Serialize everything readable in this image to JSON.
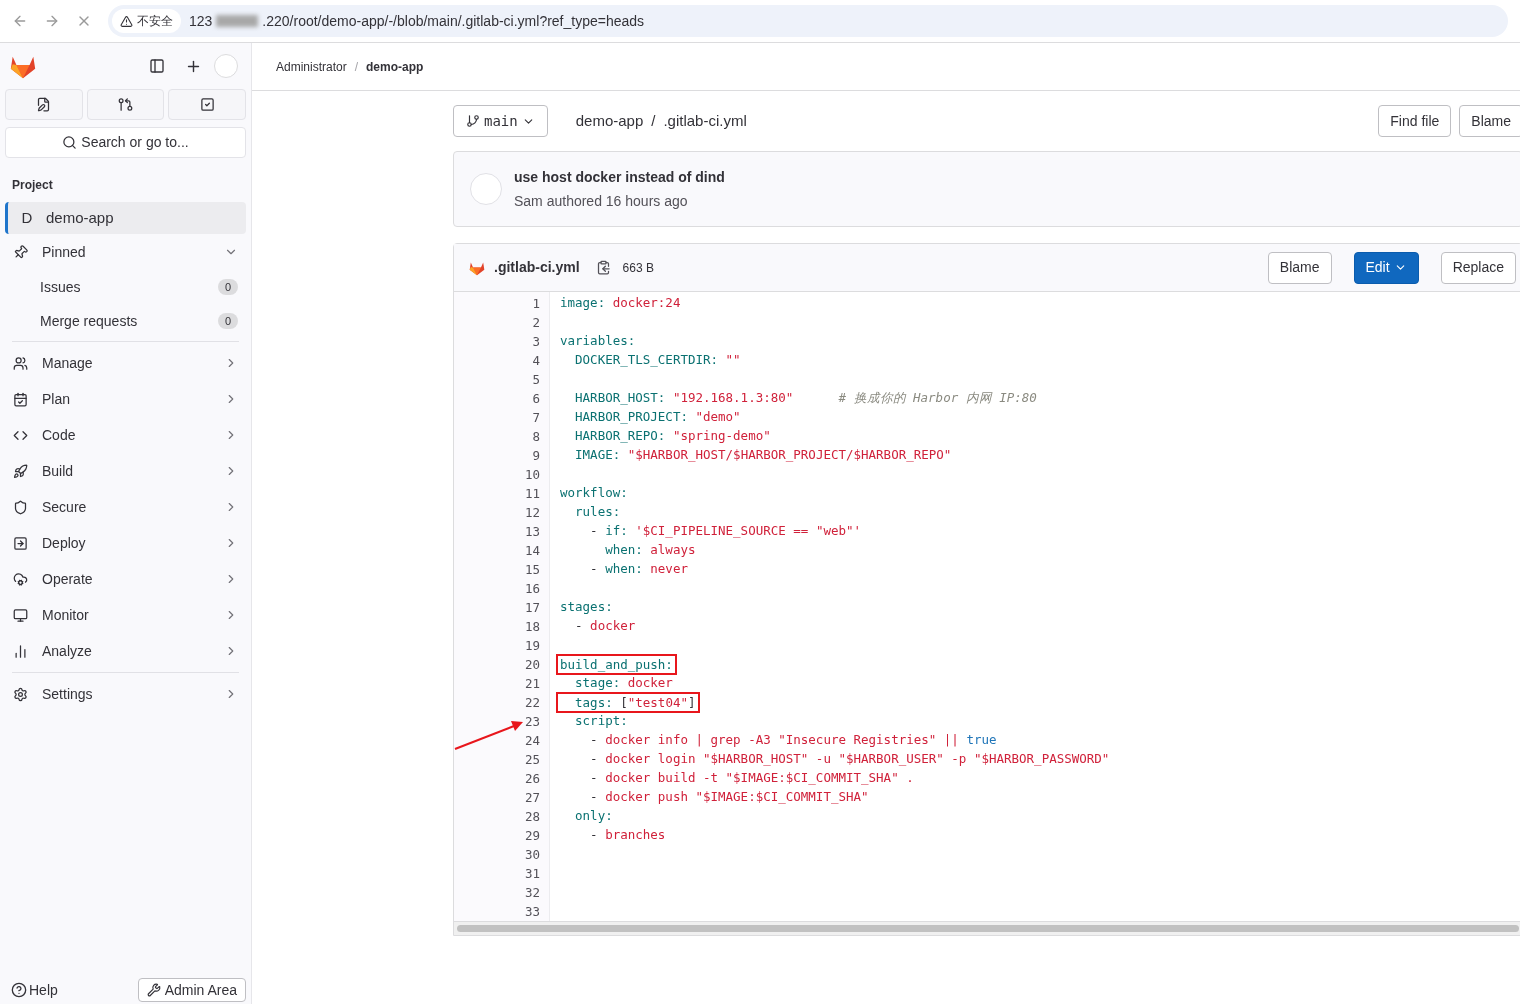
{
  "browser": {
    "security_label": "不安全",
    "url_start": "123",
    "url_end": ".220/root/demo-app/-/blob/main/.gitlab-ci.yml?ref_type=heads"
  },
  "sidebar": {
    "search_placeholder": "Search or go to...",
    "section_title": "Project",
    "items": [
      {
        "kind": "project",
        "avatar": "D",
        "label": "demo-app",
        "selected": true
      },
      {
        "kind": "group",
        "label": "Pinned",
        "expanded": true,
        "children": [
          {
            "label": "Issues",
            "count": "0"
          },
          {
            "label": "Merge requests",
            "count": "0"
          }
        ]
      },
      {
        "kind": "nav",
        "label": "Manage"
      },
      {
        "kind": "nav",
        "label": "Plan"
      },
      {
        "kind": "nav",
        "label": "Code"
      },
      {
        "kind": "nav",
        "label": "Build"
      },
      {
        "kind": "nav",
        "label": "Secure"
      },
      {
        "kind": "nav",
        "label": "Deploy"
      },
      {
        "kind": "nav",
        "label": "Operate"
      },
      {
        "kind": "nav",
        "label": "Monitor"
      },
      {
        "kind": "nav",
        "label": "Analyze"
      },
      {
        "kind": "separated",
        "label": "Settings"
      }
    ],
    "help": "Help",
    "admin": "Admin Area"
  },
  "breadcrumb_separator": "/",
  "breadcrumbs": [
    {
      "label": "Administrator",
      "current": false
    },
    {
      "label": "demo-app",
      "current": true
    }
  ],
  "toolbar": {
    "branch": "main",
    "path_separator": "/",
    "path": [
      "demo-app",
      ".gitlab-ci.yml"
    ],
    "buttons": [
      "Find file",
      "Blame"
    ]
  },
  "commit": {
    "title": "use host docker instead of dind",
    "meta": "Sam authored 16 hours ago"
  },
  "file": {
    "name": ".gitlab-ci.yml",
    "size": "663 B",
    "buttons": [
      {
        "label": "Blame",
        "primary": false
      },
      {
        "label": "Edit",
        "primary": true
      },
      {
        "label": "Replace",
        "primary": false
      }
    ],
    "lines": [
      {
        "number": "1",
        "tokens": [
          {
            "kind": "key",
            "text": "image:"
          },
          {
            "kind": "str",
            "text": " docker:24"
          }
        ]
      },
      {
        "number": "2"
      },
      {
        "number": "3",
        "tokens": [
          {
            "kind": "key",
            "text": "variables:"
          }
        ]
      },
      {
        "number": "4",
        "tokens": [
          {
            "kind": "key",
            "text": "  DOCKER_TLS_CERTDIR:"
          },
          {
            "kind": "str",
            "text": " \"\""
          }
        ]
      },
      {
        "number": "5"
      },
      {
        "number": "6",
        "tokens": [
          {
            "kind": "key",
            "text": "  HARBOR_HOST:"
          },
          {
            "kind": "str",
            "text": " \"192.168.1.3:80\""
          },
          {
            "kind": "comment",
            "text": "      # 换成你的 Harbor 内网 IP:80"
          }
        ]
      },
      {
        "number": "7",
        "tokens": [
          {
            "kind": "key",
            "text": "  HARBOR_PROJECT:"
          },
          {
            "kind": "str",
            "text": " \"demo\""
          }
        ]
      },
      {
        "number": "8",
        "tokens": [
          {
            "kind": "key",
            "text": "  HARBOR_REPO:"
          },
          {
            "kind": "str",
            "text": " \"spring-demo\""
          }
        ]
      },
      {
        "number": "9",
        "tokens": [
          {
            "kind": "key",
            "text": "  IMAGE:"
          },
          {
            "kind": "str",
            "text": " \"$HARBOR_HOST/$HARBOR_PROJECT/$HARBOR_REPO\""
          }
        ]
      },
      {
        "number": "10"
      },
      {
        "number": "11",
        "tokens": [
          {
            "kind": "key",
            "text": "workflow:"
          }
        ]
      },
      {
        "number": "12",
        "tokens": [
          {
            "kind": "key",
            "text": "  rules:"
          }
        ]
      },
      {
        "number": "13",
        "tokens": [
          {
            "kind": "plain",
            "text": "    - "
          },
          {
            "kind": "key",
            "text": "if:"
          },
          {
            "kind": "str",
            "text": " '$CI_PIPELINE_SOURCE == \"web\"'"
          }
        ]
      },
      {
        "number": "14",
        "tokens": [
          {
            "kind": "key",
            "text": "      when:"
          },
          {
            "kind": "str",
            "text": " always"
          }
        ]
      },
      {
        "number": "15",
        "tokens": [
          {
            "kind": "plain",
            "text": "    - "
          },
          {
            "kind": "key",
            "text": "when:"
          },
          {
            "kind": "str",
            "text": " never"
          }
        ]
      },
      {
        "number": "16"
      },
      {
        "number": "17",
        "tokens": [
          {
            "kind": "key",
            "text": "stages:"
          }
        ]
      },
      {
        "number": "18",
        "tokens": [
          {
            "kind": "plain",
            "text": "  - "
          },
          {
            "kind": "str",
            "text": "docker"
          }
        ]
      },
      {
        "number": "19"
      },
      {
        "number": "20",
        "annotated": true,
        "tokens": [
          {
            "kind": "key",
            "text": "build_and_push:"
          }
        ]
      },
      {
        "number": "21",
        "tokens": [
          {
            "kind": "key",
            "text": "  stage:"
          },
          {
            "kind": "str",
            "text": " docker"
          }
        ]
      },
      {
        "number": "22",
        "annotated": true,
        "tokens": [
          {
            "kind": "key",
            "text": "  tags:"
          },
          {
            "kind": "plain",
            "text": " ["
          },
          {
            "kind": "str",
            "text": "\"test04\""
          },
          {
            "kind": "plain",
            "text": "]"
          }
        ]
      },
      {
        "number": "23",
        "tokens": [
          {
            "kind": "key",
            "text": "  script:"
          }
        ]
      },
      {
        "number": "24",
        "tokens": [
          {
            "kind": "plain",
            "text": "    - "
          },
          {
            "kind": "str",
            "text": "docker info | grep -A3 \"Insecure Registries\" || "
          },
          {
            "kind": "bool",
            "text": "true"
          }
        ]
      },
      {
        "number": "25",
        "tokens": [
          {
            "kind": "plain",
            "text": "    - "
          },
          {
            "kind": "str",
            "text": "docker login \"$HARBOR_HOST\" -u \"$HARBOR_USER\" -p \"$HARBOR_PASSWORD\""
          }
        ]
      },
      {
        "number": "26",
        "tokens": [
          {
            "kind": "plain",
            "text": "    - "
          },
          {
            "kind": "str",
            "text": "docker build -t \"$IMAGE:$CI_COMMIT_SHA\" ."
          }
        ]
      },
      {
        "number": "27",
        "tokens": [
          {
            "kind": "plain",
            "text": "    - "
          },
          {
            "kind": "str",
            "text": "docker push \"$IMAGE:$CI_COMMIT_SHA\""
          }
        ]
      },
      {
        "number": "28",
        "tokens": [
          {
            "kind": "key",
            "text": "  only:"
          }
        ]
      },
      {
        "number": "29",
        "tokens": [
          {
            "kind": "plain",
            "text": "    - "
          },
          {
            "kind": "str",
            "text": "branches"
          }
        ]
      },
      {
        "number": "30"
      },
      {
        "number": "31"
      },
      {
        "number": "32"
      },
      {
        "number": "33"
      }
    ]
  }
}
